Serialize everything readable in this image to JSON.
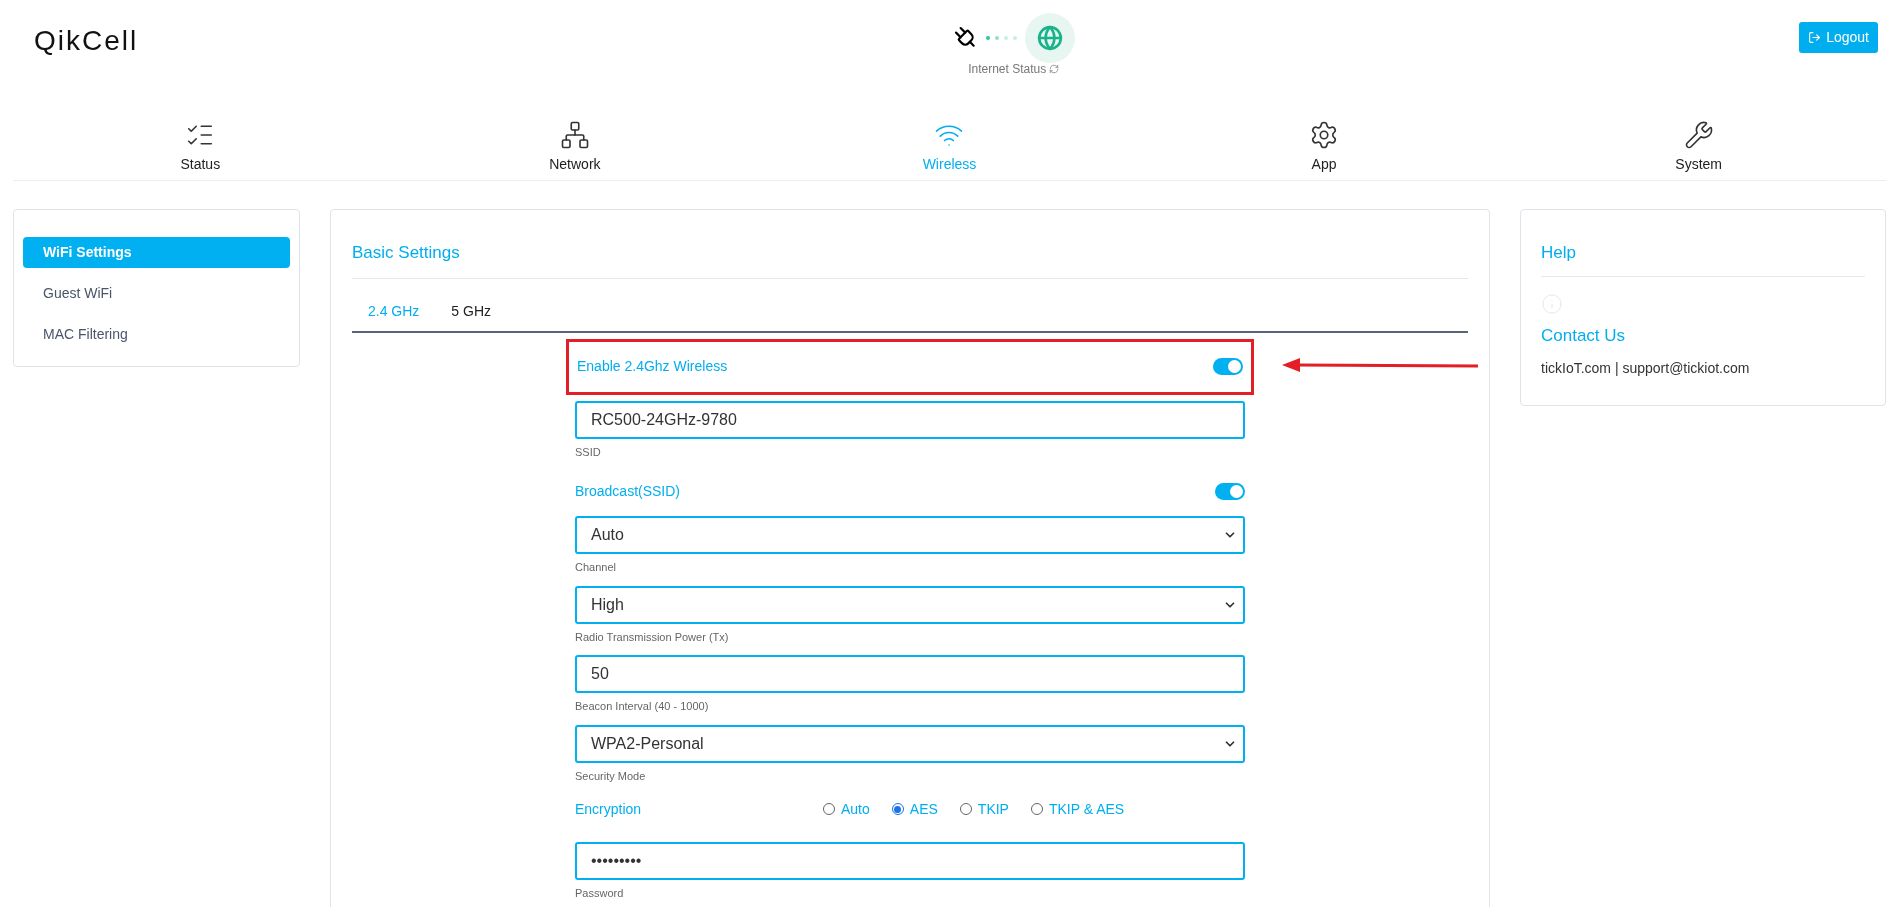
{
  "brand": "QikCell",
  "internet_status": {
    "label": "Internet Status"
  },
  "logout": "Logout",
  "nav": [
    {
      "label": "Status",
      "kind": "status",
      "selected": false
    },
    {
      "label": "Network",
      "kind": "network",
      "selected": false
    },
    {
      "label": "Wireless",
      "kind": "wireless",
      "selected": true
    },
    {
      "label": "App",
      "kind": "app",
      "selected": false
    },
    {
      "label": "System",
      "kind": "system",
      "selected": false
    }
  ],
  "sidebar": {
    "items": [
      {
        "label": "WiFi Settings",
        "selected": true
      },
      {
        "label": "Guest WiFi",
        "selected": false
      },
      {
        "label": "MAC Filtering",
        "selected": false
      }
    ]
  },
  "panel": {
    "title": "Basic Settings",
    "tabs": [
      {
        "label": "2.4 GHz",
        "selected": true
      },
      {
        "label": "5 GHz",
        "selected": false
      }
    ],
    "fields": [
      {
        "kind": "toggle",
        "label": "Enable 2.4Ghz Wireless",
        "on": true,
        "highlighted": true
      },
      {
        "kind": "text",
        "value": "RC500-24GHz-9780",
        "caption": "SSID"
      },
      {
        "kind": "toggle",
        "label": "Broadcast(SSID)",
        "on": true,
        "highlighted": false
      },
      {
        "kind": "select",
        "value": "Auto",
        "caption": "Channel"
      },
      {
        "kind": "select",
        "value": "High",
        "caption": "Radio Transmission Power (Tx)"
      },
      {
        "kind": "text",
        "value": "50",
        "caption": "Beacon Interval (40 - 1000)"
      },
      {
        "kind": "select",
        "value": "WPA2-Personal",
        "caption": "Security Mode"
      },
      {
        "kind": "radio",
        "label": "Encryption",
        "options": [
          {
            "label": "Auto",
            "selected": false
          },
          {
            "label": "AES",
            "selected": true
          },
          {
            "label": "TKIP",
            "selected": false
          },
          {
            "label": "TKIP & AES",
            "selected": false
          }
        ]
      },
      {
        "kind": "password",
        "value": "•••••••••",
        "caption": "Password"
      }
    ]
  },
  "help": {
    "title": "Help",
    "contact_title": "Contact Us",
    "contact_text": "tickIoT.com | support@tickiot.com"
  }
}
